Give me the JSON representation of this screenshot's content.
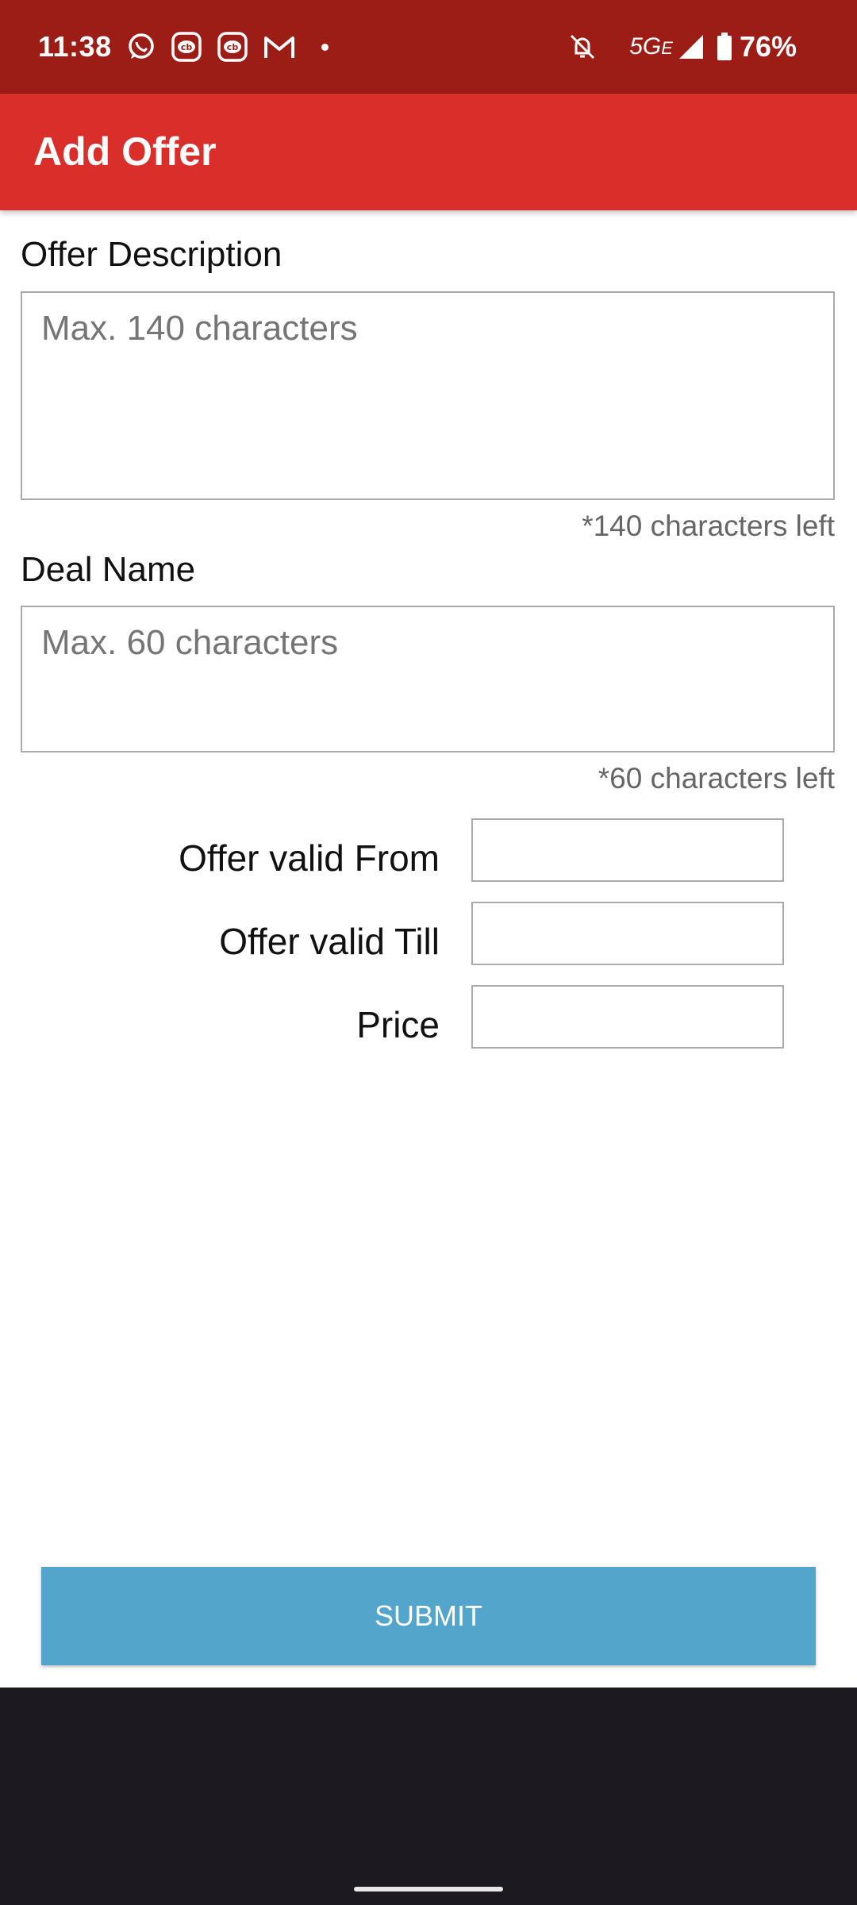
{
  "status_bar": {
    "time": "11:38",
    "left_icons": [
      "whatsapp-icon",
      "cb-app-icon",
      "cb-app-icon",
      "gmail-icon",
      "notification-dot-icon"
    ],
    "network": "5G",
    "network_sub": "E",
    "battery": "76%",
    "battery_level": 0.76
  },
  "app_bar": {
    "title": "Add Offer",
    "background": "#da2e2b"
  },
  "form": {
    "offer_description": {
      "label": "Offer Description",
      "placeholder": "Max. 140 characters",
      "value": "",
      "counter": "*140 characters left"
    },
    "deal_name": {
      "label": "Deal Name",
      "placeholder": "Max. 60 characters",
      "value": "",
      "counter": "*60 characters left"
    },
    "valid_from": {
      "label": "Offer valid From",
      "value": ""
    },
    "valid_till": {
      "label": "Offer valid Till",
      "value": ""
    },
    "price": {
      "label": "Price",
      "value": ""
    }
  },
  "submit": {
    "label": "SUBMIT",
    "background": "#54a5cc"
  }
}
